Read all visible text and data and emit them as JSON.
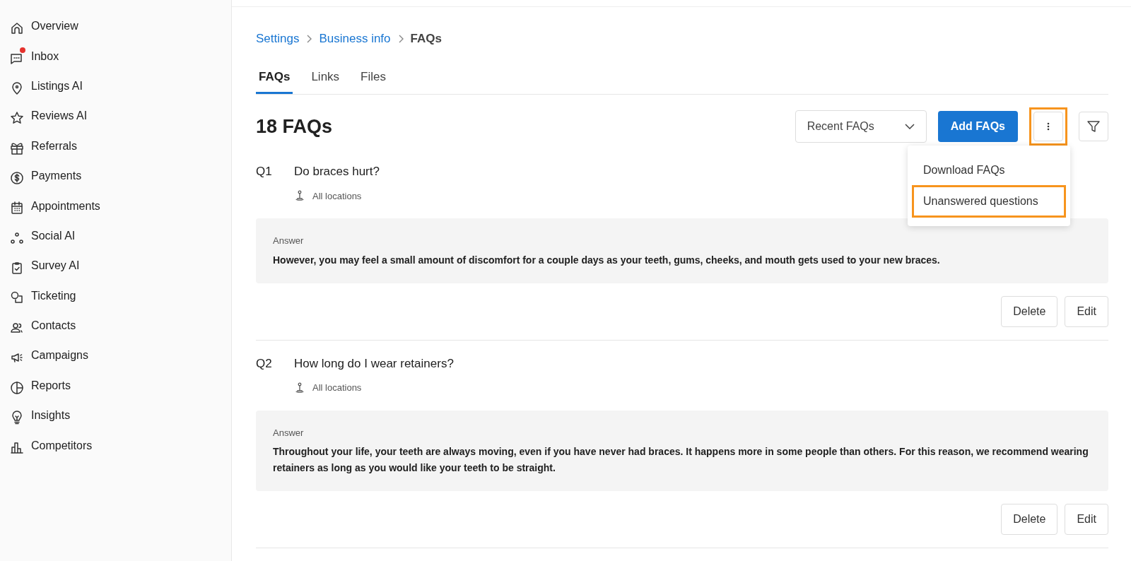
{
  "sidebar": {
    "items": [
      {
        "label": "Overview",
        "notification": false
      },
      {
        "label": "Inbox",
        "notification": true
      },
      {
        "label": "Listings AI",
        "notification": false
      },
      {
        "label": "Reviews AI",
        "notification": false
      },
      {
        "label": "Referrals",
        "notification": false
      },
      {
        "label": "Payments",
        "notification": false
      },
      {
        "label": "Appointments",
        "notification": false
      },
      {
        "label": "Social AI",
        "notification": false
      },
      {
        "label": "Survey AI",
        "notification": false
      },
      {
        "label": "Ticketing",
        "notification": false
      },
      {
        "label": "Contacts",
        "notification": false
      },
      {
        "label": "Campaigns",
        "notification": false
      },
      {
        "label": "Reports",
        "notification": false
      },
      {
        "label": "Insights",
        "notification": false
      },
      {
        "label": "Competitors",
        "notification": false
      }
    ]
  },
  "breadcrumb": [
    "Settings",
    "Business info",
    "FAQs"
  ],
  "tabs": [
    {
      "label": "FAQs",
      "selected": true
    },
    {
      "label": "Links",
      "selected": false
    },
    {
      "label": "Files",
      "selected": false
    }
  ],
  "heading": "18 FAQs",
  "toolbar": {
    "sort": "Recent FAQs",
    "add_button": "Add FAQs",
    "more_highlighted": true
  },
  "menu": {
    "items": [
      {
        "label": "Download FAQs",
        "highlighted": false
      },
      {
        "label": "Unanswered questions",
        "highlighted": true
      }
    ]
  },
  "faqs": [
    {
      "number": "Q1",
      "question": "Do braces hurt?",
      "location": "All locations",
      "answer_label": "Answer",
      "answer": "However, you may feel a small amount of discomfort for a couple days as your teeth, gums, cheeks, and mouth gets used to your new braces.",
      "actions": [
        "Delete",
        "Edit"
      ]
    },
    {
      "number": "Q2",
      "question": "How long do I wear retainers?",
      "location": "All locations",
      "answer_label": "Answer",
      "answer": "Throughout your life, your teeth are always moving, even if you have never had braces. It happens more in some people than others. For this reason, we recommend wearing retainers as long as you would like your teeth to be straight.",
      "actions": [
        "Delete",
        "Edit"
      ]
    }
  ]
}
